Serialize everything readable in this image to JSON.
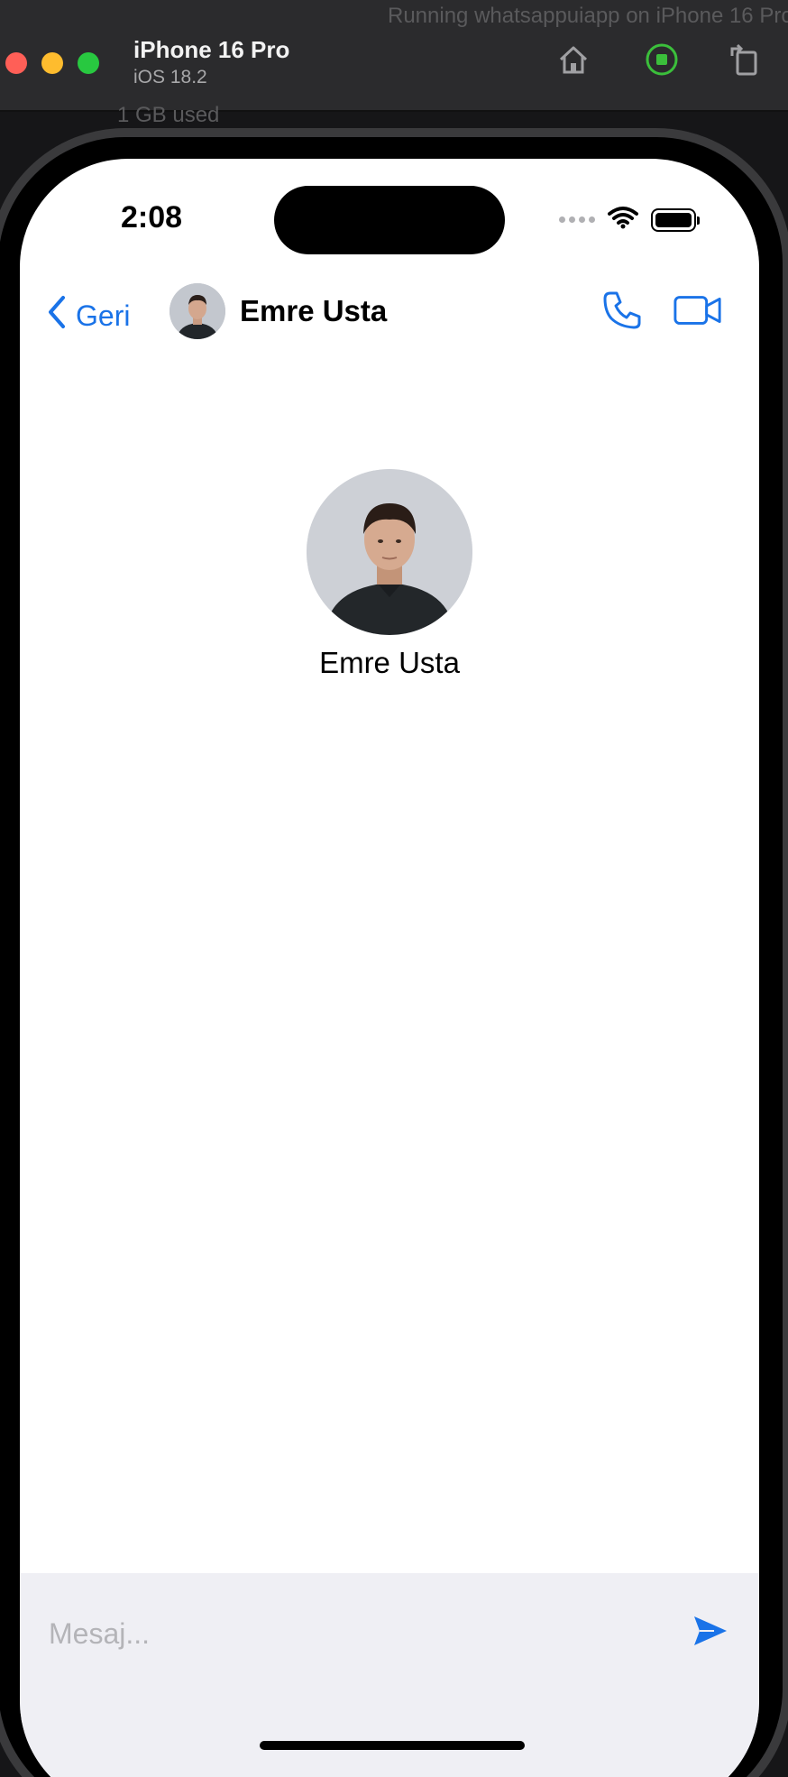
{
  "simulator": {
    "device_name": "iPhone 16 Pro",
    "os_version": "iOS 18.2",
    "background_text_top": "Running whatsappuiapp on iPhone 16 Pro",
    "background_text_mid": "1 GB used",
    "icons": [
      "home-icon",
      "stop-icon",
      "rotate-icon"
    ]
  },
  "status_bar": {
    "time": "2:08"
  },
  "nav": {
    "back_label": "Geri",
    "contact_name": "Emre Usta",
    "icons": [
      "chevron-left-icon",
      "phone-icon",
      "video-icon"
    ]
  },
  "profile": {
    "name": "Emre Usta"
  },
  "composer": {
    "placeholder": "Mesaj...",
    "value": "",
    "icons": [
      "send-icon"
    ]
  },
  "colors": {
    "accent": "#1a73e8",
    "composer_bg": "#efeff4",
    "red": "#ff5f57",
    "yellow": "#febc2e",
    "green": "#28c840"
  }
}
